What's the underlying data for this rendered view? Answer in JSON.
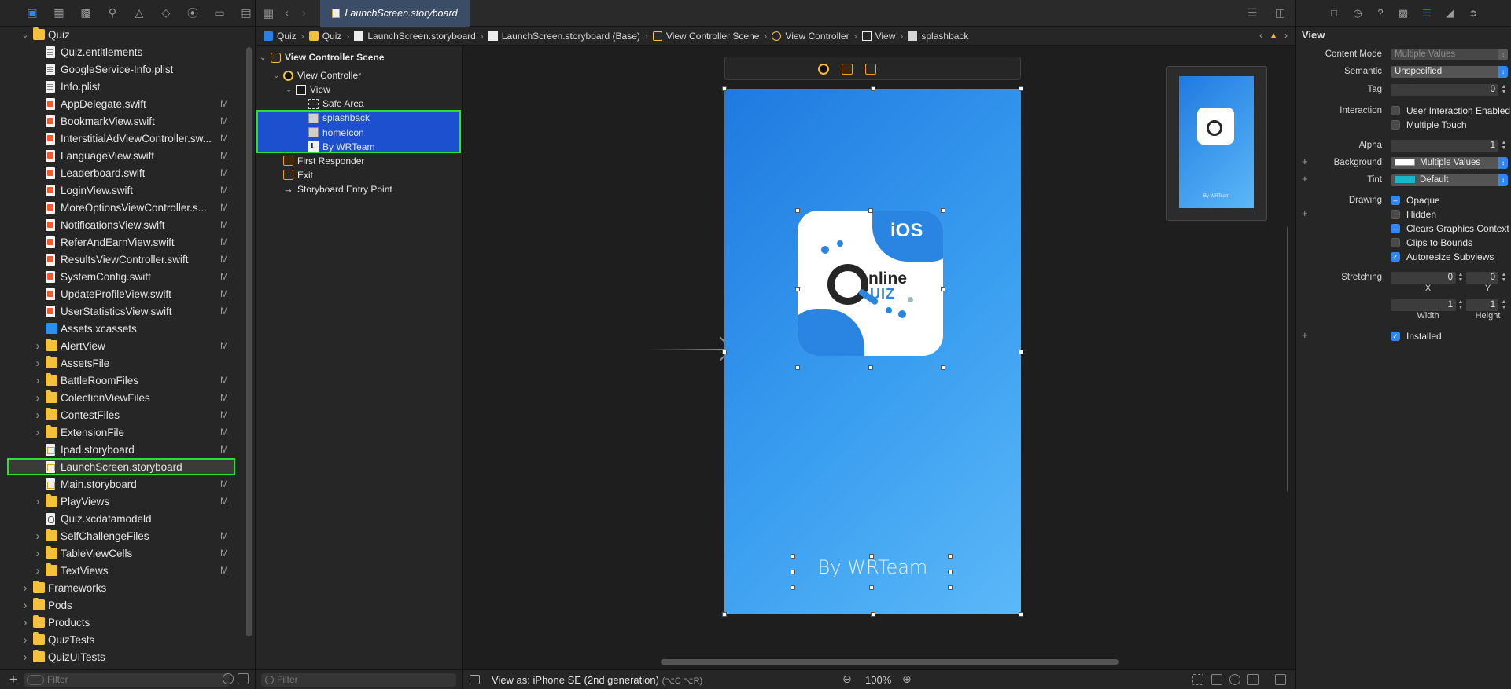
{
  "navigator": {
    "filter_placeholder": "Filter",
    "items": [
      {
        "label": "Quiz",
        "type": "folder",
        "expanded": true,
        "flag": ""
      },
      {
        "label": "Quiz.entitlements",
        "type": "plain",
        "flag": ""
      },
      {
        "label": "GoogleService-Info.plist",
        "type": "plain",
        "flag": ""
      },
      {
        "label": "Info.plist",
        "type": "plain",
        "flag": ""
      },
      {
        "label": "AppDelegate.swift",
        "type": "swift",
        "flag": "M"
      },
      {
        "label": "BookmarkView.swift",
        "type": "swift",
        "flag": "M"
      },
      {
        "label": "InterstitialAdViewController.sw...",
        "type": "swift",
        "flag": "M"
      },
      {
        "label": "LanguageView.swift",
        "type": "swift",
        "flag": "M"
      },
      {
        "label": "Leaderboard.swift",
        "type": "swift",
        "flag": "M"
      },
      {
        "label": "LoginView.swift",
        "type": "swift",
        "flag": "M"
      },
      {
        "label": "MoreOptionsViewController.s...",
        "type": "swift",
        "flag": "M"
      },
      {
        "label": "NotificationsView.swift",
        "type": "swift",
        "flag": "M"
      },
      {
        "label": "ReferAndEarnView.swift",
        "type": "swift",
        "flag": "M"
      },
      {
        "label": "ResultsViewController.swift",
        "type": "swift",
        "flag": "M"
      },
      {
        "label": "SystemConfig.swift",
        "type": "swift",
        "flag": "M"
      },
      {
        "label": "UpdateProfileView.swift",
        "type": "swift",
        "flag": "M"
      },
      {
        "label": "UserStatisticsView.swift",
        "type": "swift",
        "flag": "M"
      },
      {
        "label": "Assets.xcassets",
        "type": "assets",
        "flag": ""
      },
      {
        "label": "AlertView",
        "type": "folder",
        "flag": "M"
      },
      {
        "label": "AssetsFile",
        "type": "folder",
        "flag": ""
      },
      {
        "label": "BattleRoomFiles",
        "type": "folder",
        "flag": "M"
      },
      {
        "label": "ColectionViewFiles",
        "type": "folder",
        "flag": "M"
      },
      {
        "label": "ContestFiles",
        "type": "folder",
        "flag": "M"
      },
      {
        "label": "ExtensionFile",
        "type": "folder",
        "flag": "M"
      },
      {
        "label": "Ipad.storyboard",
        "type": "sb",
        "flag": "M"
      },
      {
        "label": "LaunchScreen.storyboard",
        "type": "sb",
        "flag": "",
        "selected": true
      },
      {
        "label": "Main.storyboard",
        "type": "sb",
        "flag": "M"
      },
      {
        "label": "PlayViews",
        "type": "folder",
        "flag": "M"
      },
      {
        "label": "Quiz.xcdatamodeld",
        "type": "model",
        "flag": ""
      },
      {
        "label": "SelfChallengeFiles",
        "type": "folder",
        "flag": "M"
      },
      {
        "label": "TableViewCells",
        "type": "folder",
        "flag": "M"
      },
      {
        "label": "TextViews",
        "type": "folder",
        "flag": "M"
      },
      {
        "label": "Frameworks",
        "type": "folder",
        "flag": ""
      },
      {
        "label": "Pods",
        "type": "folder",
        "flag": ""
      },
      {
        "label": "Products",
        "type": "folder",
        "flag": ""
      },
      {
        "label": "QuizTests",
        "type": "folder",
        "flag": ""
      },
      {
        "label": "QuizUITests",
        "type": "folder",
        "flag": ""
      }
    ]
  },
  "editor": {
    "tab_title": "LaunchScreen.storyboard",
    "jumpbar": [
      "Quiz",
      "Quiz",
      "LaunchScreen.storyboard",
      "LaunchScreen.storyboard (Base)",
      "View Controller Scene",
      "View Controller",
      "View",
      "splashback"
    ]
  },
  "outline": {
    "filter_placeholder": "Filter",
    "items": [
      {
        "label": "View Controller Scene",
        "header": true
      },
      {
        "label": "View Controller"
      },
      {
        "label": "View"
      },
      {
        "label": "Safe Area"
      },
      {
        "label": "splashback"
      },
      {
        "label": "homeIcon"
      },
      {
        "label": "By WRTeam"
      },
      {
        "label": "First Responder"
      },
      {
        "label": "Exit"
      },
      {
        "label": "Storyboard Entry Point"
      }
    ]
  },
  "canvas": {
    "icon_ios_text": "iOS",
    "icon_online_text": "nline",
    "icon_quiz_text": "UIZ",
    "by_label": "By WRTeam",
    "minimap_by_label": "By WRTeam",
    "view_as": "View as: iPhone SE (2nd generation)",
    "view_as_shortcut": "(⌥C ⌥R)",
    "zoom": "100%",
    "background_gradient": [
      "#1f7ae0",
      "#5bb8f8"
    ]
  },
  "inspector": {
    "title": "View",
    "content_mode_label": "Content Mode",
    "content_mode_value": "Multiple Values",
    "semantic_label": "Semantic",
    "semantic_value": "Unspecified",
    "tag_label": "Tag",
    "tag_value": "0",
    "interaction_label": "Interaction",
    "user_interaction": "User Interaction Enabled",
    "multiple_touch": "Multiple Touch",
    "alpha_label": "Alpha",
    "alpha_value": "1",
    "background_label": "Background",
    "background_value": "Multiple Values",
    "tint_label": "Tint",
    "tint_value": "Default",
    "drawing_label": "Drawing",
    "opaque": "Opaque",
    "hidden": "Hidden",
    "clears_graphics": "Clears Graphics Context",
    "clips_to_bounds": "Clips to Bounds",
    "autoresize": "Autoresize Subviews",
    "stretching_label": "Stretching",
    "stretch_x": "0",
    "stretch_y": "0",
    "stretch_w": "1",
    "stretch_h": "1",
    "x_caption": "X",
    "y_caption": "Y",
    "width_caption": "Width",
    "height_caption": "Height",
    "installed": "Installed",
    "checkbox_mark": "✓",
    "mixed_mark": "–",
    "accent_color": "#2f86f5",
    "tint_color": "#19b5c9"
  }
}
